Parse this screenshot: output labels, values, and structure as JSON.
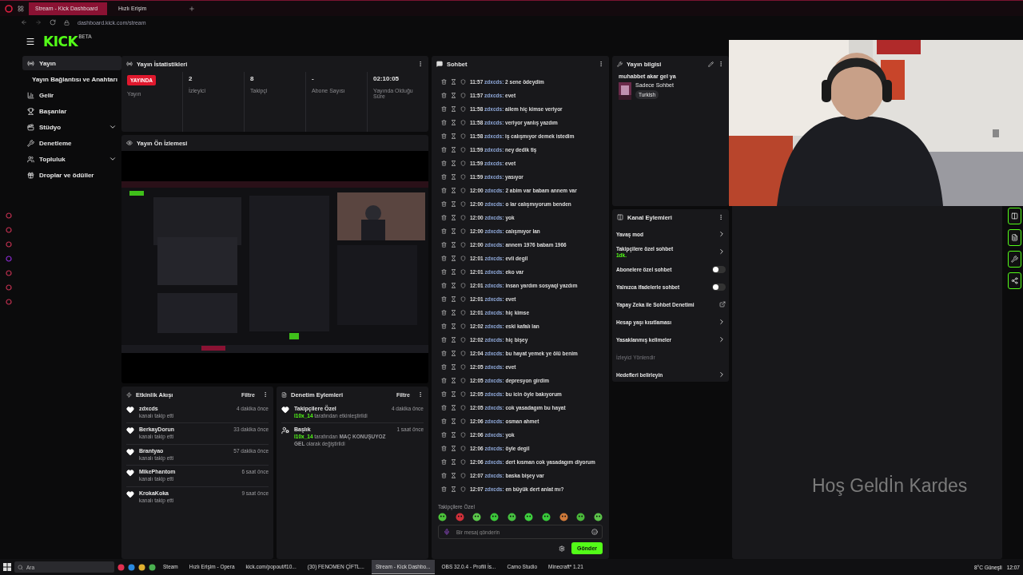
{
  "browser": {
    "tabs": [
      {
        "label": "Stream - Kick Dashboard",
        "selected": true
      },
      {
        "label": "Hızlı Erişim",
        "selected": false
      }
    ],
    "address": "dashboard.kick.com/stream"
  },
  "header": {
    "logo": "KICK",
    "logo_badge": "BETA"
  },
  "sidebar": {
    "items": [
      {
        "label": "Yayın",
        "kind": "link",
        "selected": true
      },
      {
        "label": "Yayın Bağlantısı ve Anahtarı",
        "kind": "sub",
        "selected": false
      },
      {
        "label": "Gelir",
        "kind": "link",
        "selected": false
      },
      {
        "label": "Başarılar",
        "kind": "link",
        "selected": false
      },
      {
        "label": "Stüdyo",
        "kind": "group",
        "selected": false
      },
      {
        "label": "Denetleme",
        "kind": "link",
        "selected": false
      },
      {
        "label": "Topluluk",
        "kind": "group",
        "selected": false
      },
      {
        "label": "Droplar ve ödüller",
        "kind": "link",
        "selected": false
      }
    ]
  },
  "stats": {
    "title": "Yayın İstatistikleri",
    "items": [
      {
        "value": "YAYINDA",
        "label": "Yayın",
        "kind": "badge"
      },
      {
        "value": "2",
        "label": "İzleyici",
        "kind": "number"
      },
      {
        "value": "8",
        "label": "Takipçi",
        "kind": "number"
      },
      {
        "value": "-",
        "label": "Abone Sayısı",
        "kind": "number"
      },
      {
        "value": "02:10:05",
        "label": "Yayında Olduğu Süre",
        "kind": "number"
      }
    ]
  },
  "preview": {
    "title": "Yayın Ön İzlemesi"
  },
  "activity": {
    "title": "Etkinlik Akışı",
    "filter": "Filtre",
    "items": [
      {
        "name": "zdxcds",
        "action": "kanalı takip etti",
        "time": "4 dakika önce"
      },
      {
        "name": "BerkayDorun",
        "action": "kanalı takip etti",
        "time": "33 dakika önce"
      },
      {
        "name": "Brantyao",
        "action": "kanalı takip etti",
        "time": "57 dakika önce"
      },
      {
        "name": "MikePhantom",
        "action": "kanalı takip etti",
        "time": "6 saat önce"
      },
      {
        "name": "KrokaKoka",
        "action": "kanalı takip etti",
        "time": "9 saat önce"
      }
    ]
  },
  "moderation": {
    "title": "Denetim Eylemleri",
    "filter": "Filtre",
    "items": [
      {
        "kind": "follower",
        "title": "Takipçilere Özel",
        "user": "l10x_14",
        "text": "tarafından etkinleştirildi",
        "time": "4 dakika önce"
      },
      {
        "kind": "title",
        "title": "Başlık",
        "user": "l10x_14",
        "text": "tarafından **MAÇ KONUŞUYOZ GEL** olarak değiştirildi",
        "time": "1 saat önce"
      }
    ]
  },
  "chat": {
    "title": "Sohbet",
    "messages": [
      {
        "time": "11:57",
        "user": "zdxcds:",
        "text": "2 sene ödeydim"
      },
      {
        "time": "11:57",
        "user": "zdxcds:",
        "text": "evet"
      },
      {
        "time": "11:58",
        "user": "zdxcds:",
        "text": "ailem hiç kimse veriyor"
      },
      {
        "time": "11:58",
        "user": "zdxcds:",
        "text": "veriyor yanlış yazdım"
      },
      {
        "time": "11:58",
        "user": "zdxcds:",
        "text": "iş calışmıyor demek istedim"
      },
      {
        "time": "11:59",
        "user": "zdxcds:",
        "text": "ney dedik tiş"
      },
      {
        "time": "11:59",
        "user": "zdxcds:",
        "text": "evet"
      },
      {
        "time": "11:59",
        "user": "zdxcds:",
        "text": "yasıyor"
      },
      {
        "time": "12:00",
        "user": "zdxcds:",
        "text": "2 abim var babam annem var"
      },
      {
        "time": "12:00",
        "user": "zdxcds:",
        "text": "o lar calışmıyorum benden"
      },
      {
        "time": "12:00",
        "user": "zdxcds:",
        "text": "yok"
      },
      {
        "time": "12:00",
        "user": "zdxcds:",
        "text": "calışmıyor lan"
      },
      {
        "time": "12:00",
        "user": "zdxcds:",
        "text": "annem 1976 babam 1966"
      },
      {
        "time": "12:01",
        "user": "zdxcds:",
        "text": "evli degil"
      },
      {
        "time": "12:01",
        "user": "zdxcds:",
        "text": "eko var"
      },
      {
        "time": "12:01",
        "user": "zdxcds:",
        "text": "insan yardım sosyaql yazdım"
      },
      {
        "time": "12:01",
        "user": "zdxcds:",
        "text": "evet"
      },
      {
        "time": "12:01",
        "user": "zdxcds:",
        "text": "hiç kimse"
      },
      {
        "time": "12:02",
        "user": "zdxcds:",
        "text": "eski kafalı lan"
      },
      {
        "time": "12:02",
        "user": "zdxcds:",
        "text": "hiç bişey"
      },
      {
        "time": "12:04",
        "user": "zdxcds:",
        "text": "bu hayat yemek ye ölü benim"
      },
      {
        "time": "12:05",
        "user": "zdxcds:",
        "text": "evet"
      },
      {
        "time": "12:05",
        "user": "zdxcds:",
        "text": "depresyon girdim"
      },
      {
        "time": "12:05",
        "user": "zdxcds:",
        "text": "bu icin öyle bakıyorum"
      },
      {
        "time": "12:05",
        "user": "zdxcds:",
        "text": "cok yasadagım bu hayat"
      },
      {
        "time": "12:06",
        "user": "zdxcds:",
        "text": "osman ahmet"
      },
      {
        "time": "12:06",
        "user": "zdxcds:",
        "text": "yok"
      },
      {
        "time": "12:06",
        "user": "zdxcds:",
        "text": "öyle degil"
      },
      {
        "time": "12:06",
        "user": "zdxcds:",
        "text": "dert kısman cok yasadagım diyorum"
      },
      {
        "time": "12:07",
        "user": "zdxcds:",
        "text": "baska bişey var"
      },
      {
        "time": "12:07",
        "user": "zdxcds:",
        "text": "en büyük dert anlat mı?"
      }
    ],
    "mode_label": "Takipçilere Özel",
    "placeholder": "Bir mesaj gönderin",
    "send": "Gönder"
  },
  "stream_info": {
    "title_label": "Yayın bilgisi",
    "stream_title": "muhabbet akar gel ya",
    "category": "Sadece Sohbet",
    "tag": "Turkish"
  },
  "channel_actions": {
    "title": "Kanal Eylemleri",
    "items": [
      {
        "label": "Yavaş mod",
        "kind": "chevron",
        "disabled": false
      },
      {
        "label": "Takipçilere özel sohbet",
        "sub": "1dk.",
        "kind": "chevron",
        "disabled": false
      },
      {
        "label": "Abonelere özel sohbet",
        "kind": "toggle",
        "on": false,
        "disabled": false
      },
      {
        "label": "Yalnızca ifadelerle sohbet",
        "kind": "toggle",
        "on": false,
        "disabled": false
      },
      {
        "label": "Yapay Zeka ile Sohbet Denetimi",
        "kind": "external",
        "disabled": false
      },
      {
        "label": "Hesap yaşı kısıtlaması",
        "kind": "chevron",
        "disabled": false
      },
      {
        "label": "Yasaklanmış kelimeler",
        "kind": "chevron",
        "disabled": false
      },
      {
        "label": "İzleyici Yönlendir",
        "kind": "plain",
        "disabled": true
      },
      {
        "label": "Hedefleri belirleyin",
        "kind": "chevron",
        "disabled": false
      }
    ]
  },
  "overlay_text": "Hoş Geldİn Kardes",
  "taskbar": {
    "search": "Ara",
    "items": [
      {
        "label": "Steam",
        "selected": false
      },
      {
        "label": "Hızlı Erişim - Opera",
        "selected": false
      },
      {
        "label": "kick.com/popout/f10...",
        "selected": false
      },
      {
        "label": "(30) FENOMEN ÇİFTL...",
        "selected": false
      },
      {
        "label": "Stream - Kick Dashbo...",
        "selected": true
      },
      {
        "label": "OBS 32.0.4 - Profili İs...",
        "selected": false
      },
      {
        "label": "Camo Studio",
        "selected": false
      },
      {
        "label": "Minecraft* 1.21",
        "selected": false
      }
    ],
    "weather": "8°C Güneşli",
    "clock": "12:07"
  }
}
